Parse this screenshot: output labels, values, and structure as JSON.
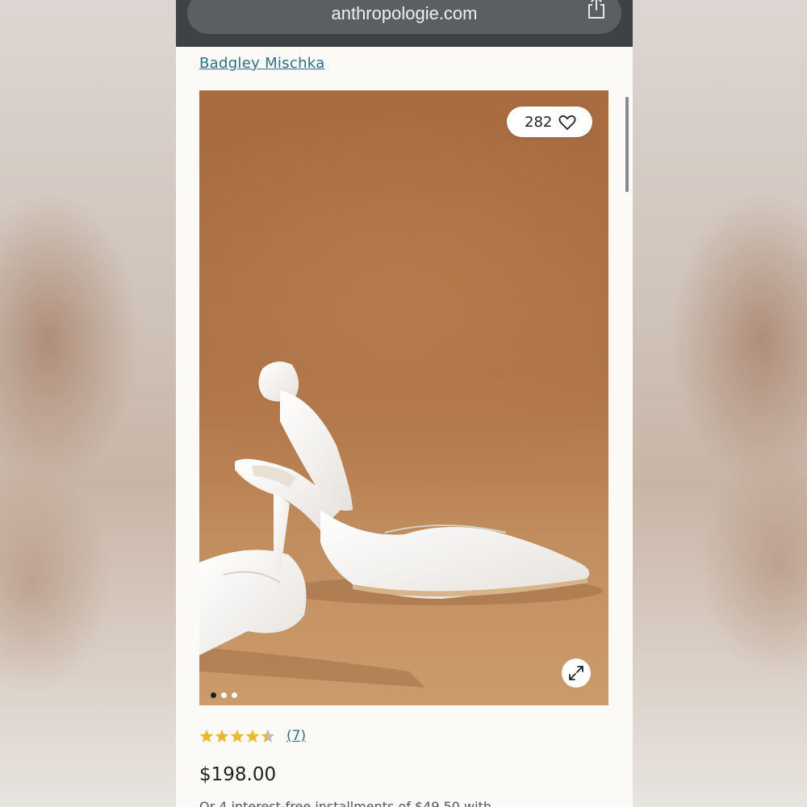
{
  "browser": {
    "url": "anthropologie.com",
    "share_icon": "share-icon"
  },
  "product": {
    "brand": "Badgley Mischka",
    "likes": "282",
    "gallery_dots": 3,
    "gallery_active_index": 0,
    "rating": 4.5,
    "rating_max": 5,
    "review_count": "(7)",
    "price": "$198.00",
    "installment_text": "Or 4 interest-free installments of $49.50 with"
  },
  "colors": {
    "browser_bar": "#3d4244",
    "url_pill": "#5a5f61",
    "link": "#2c6f86",
    "star": "#e8b931",
    "image_background": "#ad7248"
  }
}
